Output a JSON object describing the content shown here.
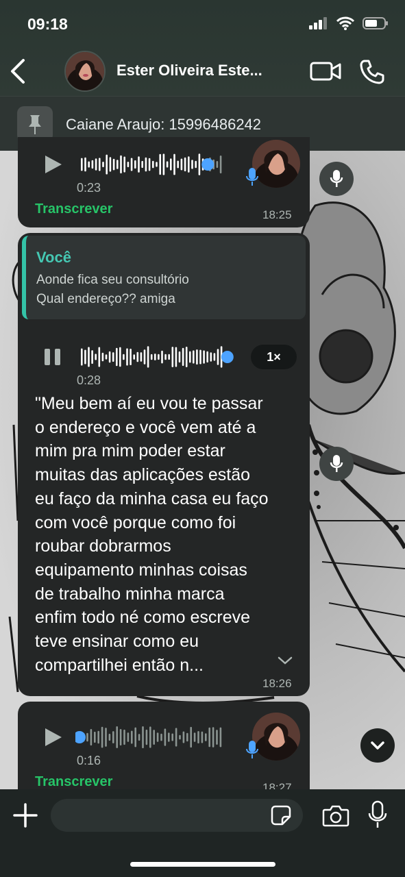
{
  "status_bar": {
    "time": "09:18"
  },
  "header": {
    "contact_name": "Ester Oliveira Este..."
  },
  "pinned": {
    "text": "Caiane Araujo: 15996486242"
  },
  "messages": [
    {
      "type": "voice",
      "duration": "0:23",
      "transcribe_label": "Transcrever",
      "time": "18:25",
      "progress": 0.87
    },
    {
      "type": "voice-reply",
      "quote_author": "Você",
      "quote_line1": "Aonde fica seu consultório",
      "quote_line2": "Qual endereço?? amiga",
      "duration": "0:28",
      "speed": "1×",
      "transcript_lines": [
        "\"Meu bem aí eu vou te passar",
        "o endereço e você vem até a",
        "mim pra mim poder estar",
        "muitas das aplicações estão",
        "eu faço da minha casa eu faço",
        "com você porque como foi",
        "roubar dobrarmos",
        "equipamento minhas coisas",
        "de trabalho minha marca",
        "enfim todo né como escreve",
        "teve ensinar como eu",
        "compartilhei então n..."
      ],
      "time": "18:26",
      "progress": 0.98
    },
    {
      "type": "voice",
      "duration": "0:16",
      "transcribe_label": "Transcrever",
      "time": "18:27",
      "progress": 0.0
    }
  ],
  "composer": {
    "placeholder": ""
  },
  "colors": {
    "accent_green": "#27c468",
    "quote_teal": "#45c8b3",
    "progress_blue": "#4da3ff"
  }
}
